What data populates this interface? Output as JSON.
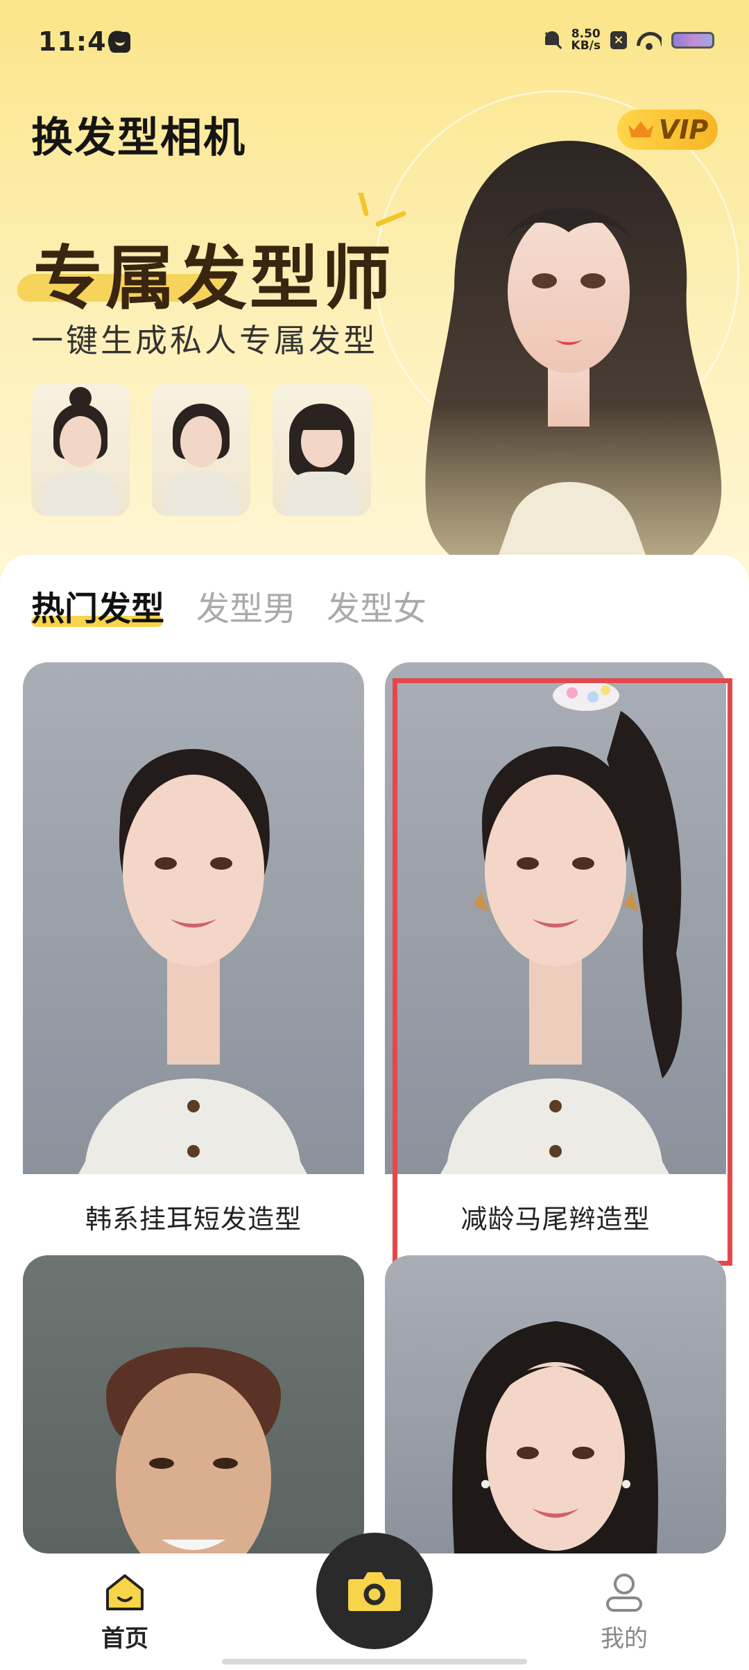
{
  "status_bar": {
    "time": "11:46",
    "speed_value": "8.50",
    "speed_unit": "KB/s",
    "x_badge": "×"
  },
  "header": {
    "app_title": "换发型相机",
    "vip_label": "VIP"
  },
  "hero": {
    "headline": "专属发型师",
    "subline": "一键生成私人专属发型",
    "thumbnails": [
      {
        "style": "hair-bun"
      },
      {
        "style": "low-ponytail"
      },
      {
        "style": "bob-bangs"
      }
    ]
  },
  "tabs": [
    {
      "label": "热门发型",
      "active": true
    },
    {
      "label": "发型男",
      "active": false
    },
    {
      "label": "发型女",
      "active": false
    }
  ],
  "cards": [
    {
      "label": "韩系挂耳短发造型"
    },
    {
      "label": "减龄马尾辫造型"
    },
    {
      "label": ""
    },
    {
      "label": ""
    }
  ],
  "bottom_nav": {
    "home_label": "首页",
    "mine_label": "我的"
  },
  "colors": {
    "accent": "#f7d449",
    "highlight": "#e4484a",
    "nav_dark": "#2a2a2a"
  }
}
